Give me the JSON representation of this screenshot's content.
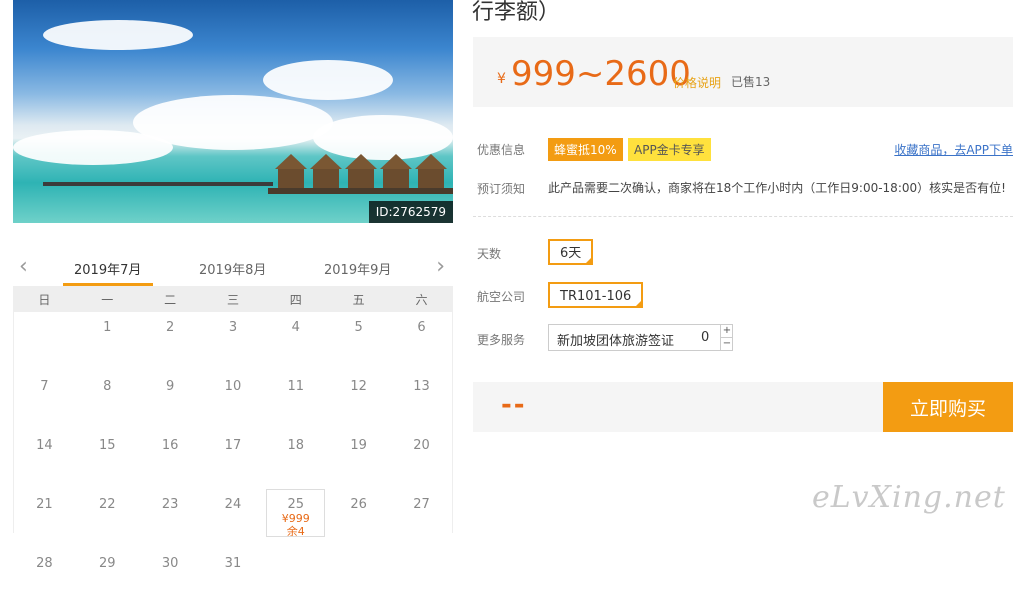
{
  "product": {
    "title_tail": "行李额）",
    "photo_id": "ID:2762579",
    "currency": "¥",
    "price": "999~2600",
    "price_note": "价格说明",
    "sold": "已售13"
  },
  "promo": {
    "label": "优惠信息",
    "tags": [
      "蜂蜜抵10%",
      "APP金卡专享"
    ],
    "favorite_link": "收藏商品，去APP下单"
  },
  "booking": {
    "label": "预订须知",
    "notice": "此产品需要二次确认，商家将在18个工作小时内（工作日9:00-18:00）核实是否有位!"
  },
  "options": {
    "days_label": "天数",
    "days_value": "6天",
    "airline_label": "航空公司",
    "airline_value": "TR101-106",
    "services_label": "更多服务",
    "service_name": "新加坡团体旅游签证",
    "service_qty": "0",
    "plus": "+",
    "minus": "−"
  },
  "purchase": {
    "total": "--",
    "buy_label": "立即购买"
  },
  "calendar": {
    "prev": "‹",
    "next": "›",
    "months": [
      "2019年7月",
      "2019年8月",
      "2019年9月"
    ],
    "weekdays": [
      "日",
      "一",
      "二",
      "三",
      "四",
      "五",
      "六"
    ],
    "weeks": [
      [
        "",
        "1",
        "2",
        "3",
        "4",
        "5",
        "6"
      ],
      [
        "7",
        "8",
        "9",
        "10",
        "11",
        "12",
        "13"
      ],
      [
        "14",
        "15",
        "16",
        "17",
        "18",
        "19",
        "20"
      ],
      [
        "21",
        "22",
        "23",
        "24",
        "25",
        "26",
        "27"
      ],
      [
        "28",
        "29",
        "30",
        "31",
        "",
        "",
        ""
      ]
    ],
    "available_price": "¥999",
    "available_stock": "余4"
  },
  "watermark": "eLvXing.net",
  "colors": {
    "accent": "#f39c12",
    "price": "#e86a17",
    "link": "#3b73c8"
  }
}
